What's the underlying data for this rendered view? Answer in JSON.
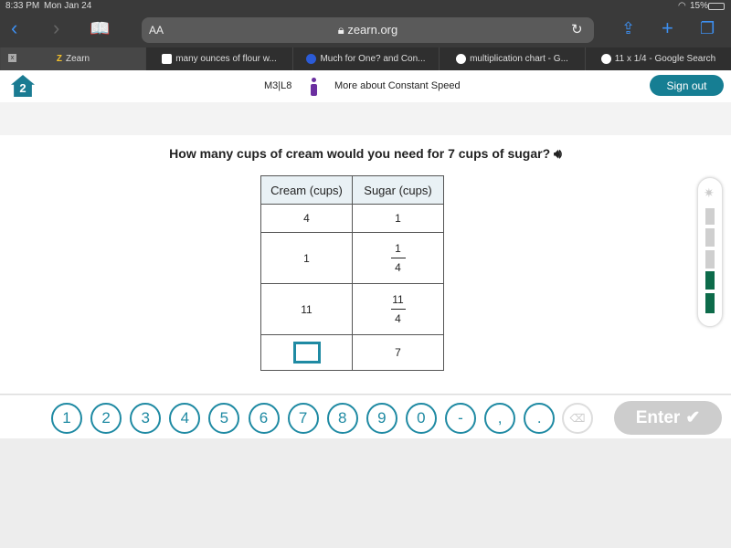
{
  "status": {
    "time": "8:33 PM",
    "date": "Mon Jan 24",
    "battery": "15%"
  },
  "browser": {
    "text_size": "AA",
    "url": "zearn.org"
  },
  "tabs": [
    {
      "label": "Zearn",
      "active": true
    },
    {
      "label": "many ounces of flour w..."
    },
    {
      "label": "Much for One? and Con..."
    },
    {
      "label": "multiplication chart - G..."
    },
    {
      "label": "11 x 1/4 - Google Search"
    }
  ],
  "header": {
    "lesson": "M3|L8",
    "title": "More about Constant Speed",
    "sign_out": "Sign out"
  },
  "question": "How many cups of cream would you need for 7 cups of sugar?",
  "table": {
    "headers": [
      "Cream (cups)",
      "Sugar (cups)"
    ],
    "rows": [
      {
        "cream": "4",
        "sugar": "1"
      },
      {
        "cream": "1",
        "sugar_num": "1",
        "sugar_den": "4"
      },
      {
        "cream": "11",
        "sugar_num": "11",
        "sugar_den": "4"
      },
      {
        "cream": "",
        "sugar": "7"
      }
    ]
  },
  "progress": {
    "completed": 2,
    "total": 5,
    "color": "#0d6b4a"
  },
  "keypad": {
    "keys": [
      "1",
      "2",
      "3",
      "4",
      "5",
      "6",
      "7",
      "8",
      "9",
      "0",
      "-",
      ",",
      "."
    ],
    "enter": "Enter",
    "accent": "#1f8aa3"
  }
}
